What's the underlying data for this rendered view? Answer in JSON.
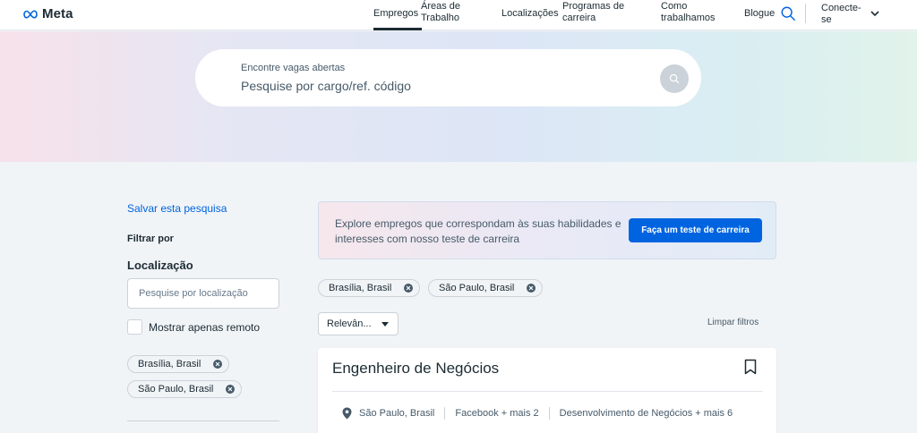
{
  "header": {
    "brand": "Meta",
    "nav": [
      {
        "line1": "Empregos",
        "line2": ""
      },
      {
        "line1": "Áreas de",
        "line2": "Trabalho"
      },
      {
        "line1": "Localizações",
        "line2": ""
      },
      {
        "line1": "Programas de",
        "line2": "carreira"
      },
      {
        "line1": "Como",
        "line2": "trabalhamos"
      },
      {
        "line1": "Blogue",
        "line2": ""
      }
    ],
    "login": {
      "line1": "Conecte-",
      "line2": "se"
    }
  },
  "search": {
    "caption": "Encontre vagas abertas",
    "placeholder": "Pesquise por cargo/ref. código"
  },
  "sidebar": {
    "save_search": "Salvar esta pesquisa",
    "filter_by": "Filtrar por",
    "location_heading": "Localização",
    "location_placeholder": "Pesquise por localização",
    "remote_only": "Mostrar apenas remoto",
    "chips": [
      "Brasília, Brasil",
      "São Paulo, Brasil"
    ]
  },
  "main": {
    "banner_text": "Explore empregos que correspondam às suas habilidades e interesses com nosso teste de carreira",
    "banner_button": "Faça um teste de carreira",
    "chips": [
      "Brasília, Brasil",
      "São Paulo, Brasil"
    ],
    "sort_value": "Relevân...",
    "clear_filters": "Limpar filtros",
    "jobs": [
      {
        "title": "Engenheiro de Negócios",
        "location": "São Paulo, Brasil",
        "team": "Facebook + mais 2",
        "area": "Desenvolvimento de Negócios + mais 6"
      }
    ]
  },
  "colors": {
    "accent": "#0064e0",
    "text": "#1c2b33",
    "muted": "#465a69"
  }
}
